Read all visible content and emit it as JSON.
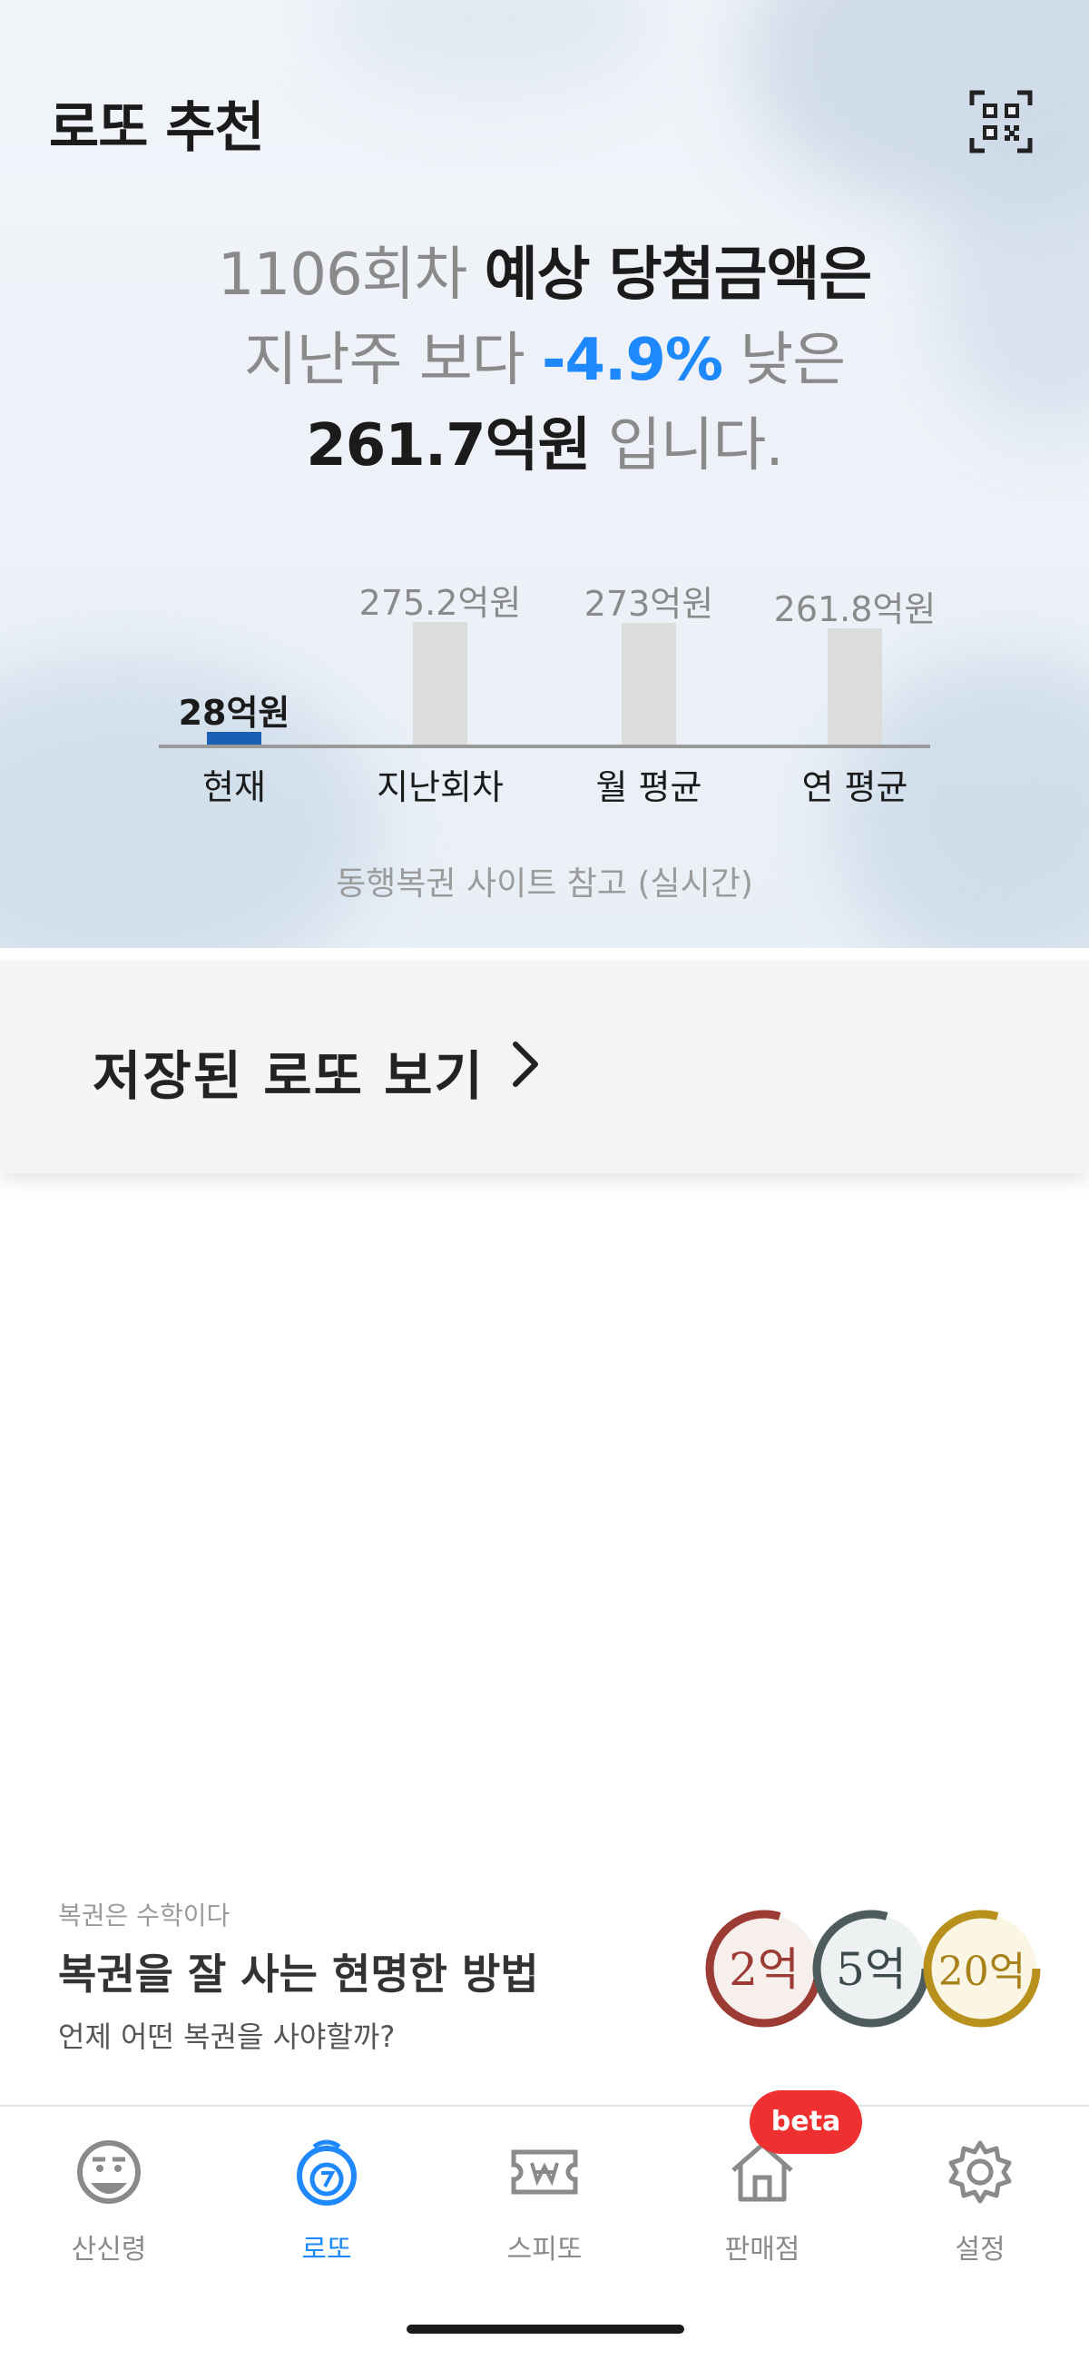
{
  "header": {
    "title": "로또 추천",
    "qr_icon": "qr-scan-icon"
  },
  "headline": {
    "round": "1106회차",
    "phrase1": "예상 당첨금액은",
    "phrase2_prefix": "지난주 보다",
    "change": "-4.9%",
    "phrase2_suffix": "낮은",
    "amount": "261.7억원",
    "phrase3_suffix": "입니다."
  },
  "chart_data": {
    "type": "bar",
    "categories": [
      "현재",
      "지난회차",
      "월 평균",
      "연 평균"
    ],
    "values": [
      28,
      275.2,
      273,
      261.8
    ],
    "labels": [
      "28억원",
      "275.2억원",
      "273억원",
      "261.8억원"
    ],
    "highlight_index": 0,
    "colors": {
      "highlight": "#1a5fb4",
      "default": "#dcdcdc"
    }
  },
  "source_note": "동행복권 사이트 참고 (실시간)",
  "saved_lotto": {
    "label": "저장된 로또 보기"
  },
  "info_banner": {
    "eyebrow": "복권은 수학이다",
    "title": "복권을 잘 사는 현명한 방법",
    "description": "언제 어떤 복권을 사야할까?",
    "coins": [
      "2억",
      "5억",
      "20억"
    ]
  },
  "nav": {
    "items": [
      {
        "label": "산신령",
        "icon": "mountain-spirit-icon"
      },
      {
        "label": "로또",
        "icon": "lotto-ball-icon"
      },
      {
        "label": "스피또",
        "icon": "ticket-icon"
      },
      {
        "label": "판매점",
        "icon": "store-icon"
      },
      {
        "label": "설정",
        "icon": "gear-icon"
      }
    ],
    "active_index": 1,
    "beta_badge": "beta"
  },
  "colors": {
    "accent": "#1e88ff",
    "badge": "#ef3030"
  }
}
